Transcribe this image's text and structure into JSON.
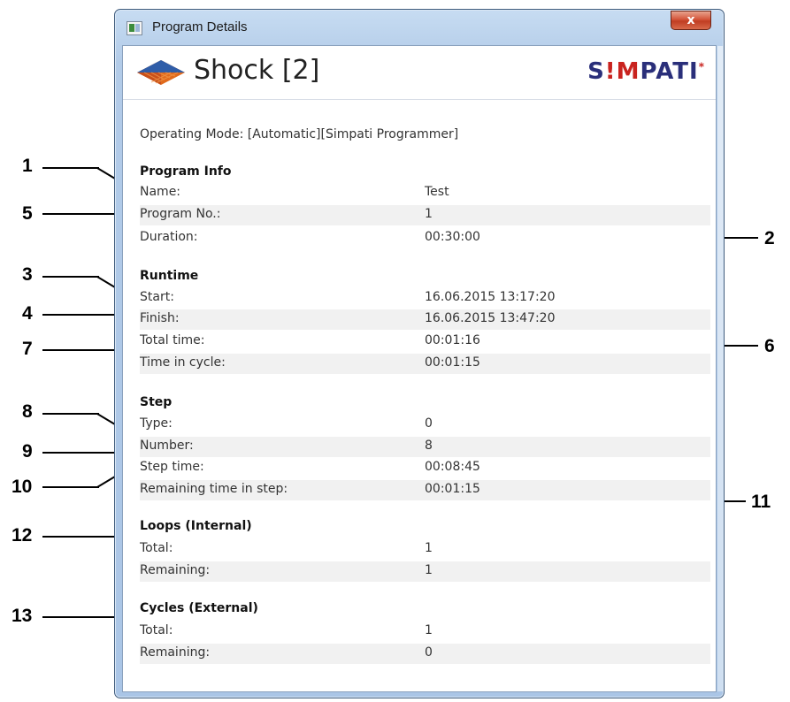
{
  "window": {
    "title": "Program Details",
    "close_label": "x"
  },
  "header": {
    "program_title": "Shock [2]",
    "brand": {
      "part1": "S",
      "accent": "!M",
      "part2": "PATI",
      "mark": "*"
    }
  },
  "operating_mode": "Operating Mode: [Automatic][Simpati Programmer]",
  "sections": {
    "program_info": {
      "title": "Program Info",
      "rows": [
        {
          "label": "Name:",
          "value": "Test"
        },
        {
          "label": "Program No.:",
          "value": "1"
        },
        {
          "label": "Duration:",
          "value": "00:30:00"
        }
      ]
    },
    "runtime": {
      "title": "Runtime",
      "rows": [
        {
          "label": "Start:",
          "value": "16.06.2015 13:17:20"
        },
        {
          "label": "Finish:",
          "value": "16.06.2015 13:47:20"
        },
        {
          "label": "Total time:",
          "value": "00:01:16"
        },
        {
          "label": "Time in cycle:",
          "value": "00:01:15"
        }
      ]
    },
    "step": {
      "title": "Step",
      "rows": [
        {
          "label": "Type:",
          "value": "0"
        },
        {
          "label": "Number:",
          "value": "8"
        },
        {
          "label": "Step time:",
          "value": "00:08:45"
        },
        {
          "label": "Remaining time in step:",
          "value": "00:01:15"
        }
      ]
    },
    "loops": {
      "title": "Loops (Internal)",
      "rows": [
        {
          "label": "Total:",
          "value": "1"
        },
        {
          "label": "Remaining:",
          "value": "1"
        }
      ]
    },
    "cycles": {
      "title": "Cycles (External)",
      "rows": [
        {
          "label": "Total:",
          "value": "1"
        },
        {
          "label": "Remaining:",
          "value": "0"
        }
      ]
    }
  },
  "callouts": [
    "1",
    "2",
    "3",
    "4",
    "5",
    "6",
    "7",
    "8",
    "9",
    "10",
    "11",
    "12",
    "13"
  ],
  "colors": {
    "frame": "#b2cbe8",
    "close_button": "#c03d22",
    "row_alt": "#f1f1f1",
    "brand_blue": "#2a2f7a",
    "brand_red": "#c9231f"
  }
}
